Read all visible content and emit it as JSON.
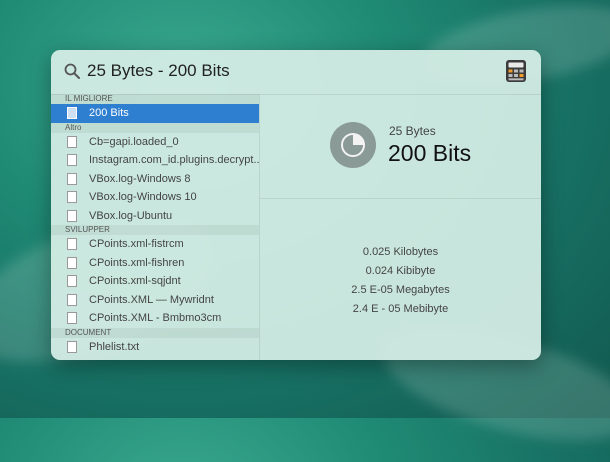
{
  "search": {
    "query": "25 Bytes - 200 Bits"
  },
  "results": {
    "sections": [
      {
        "label": "IL MIGLIORE",
        "items": [
          {
            "label": "200 Bits",
            "selected": true
          }
        ]
      },
      {
        "label": "Altro",
        "items": [
          {
            "label": "Cb=gapi.loaded_0"
          },
          {
            "label": "Instagram.com_id.plugins.decrypt..."
          },
          {
            "label": "VBox.log-Windows 8"
          },
          {
            "label": "VBox.log-Windows 10"
          },
          {
            "label": "VBox.log-Ubuntu"
          }
        ]
      },
      {
        "label": "SVILUPPER",
        "items": [
          {
            "label": "CPoints.xml-fistrcm"
          },
          {
            "label": "CPoints.xml-fishren"
          },
          {
            "label": "CPoints.xml-sqjdnt"
          },
          {
            "label": "CPoints.XML — Mywridnt"
          },
          {
            "label": "CPoints.XML - Bmbmo3cm"
          }
        ]
      },
      {
        "label": "DOCUMENT",
        "items": [
          {
            "label": "Phlelist.txt"
          }
        ]
      }
    ]
  },
  "preview": {
    "input": "25 Bytes",
    "output": "200 Bits",
    "conversions": [
      "0.025 Kilobytes",
      "0.024 Kibibyte",
      "2.5 E-05 Megabytes",
      "2.4 E - 05 Mebibyte"
    ]
  },
  "icons": {
    "search": "search-icon",
    "calculator": "calculator-icon",
    "result": "calculator-result-icon",
    "document": "document-icon"
  },
  "colors": {
    "selection": "#2f7fd1",
    "panel": "#d6eee6"
  }
}
